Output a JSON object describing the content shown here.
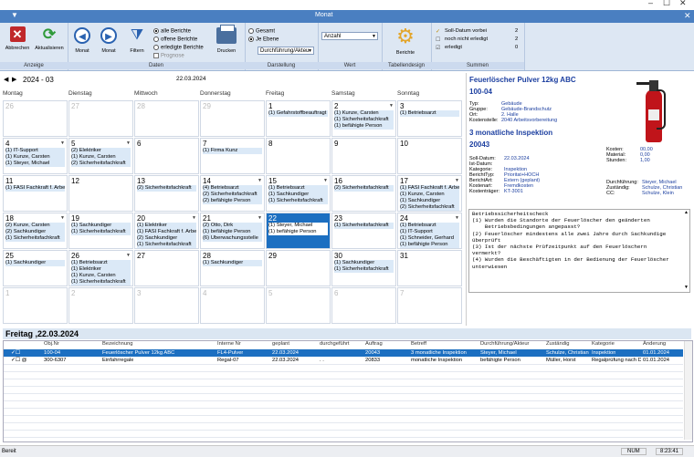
{
  "window": {
    "title": "Monat",
    "min": "–",
    "max": "☐",
    "close": "✕"
  },
  "ribbon": {
    "groups": {
      "anzeige": "Anzeige",
      "daten": "Daten",
      "darstellung": "Darstellung",
      "wert": "Wert",
      "tabellendesigner": "Tabellendesign",
      "summen": "Summen"
    },
    "buttons": {
      "abbrechen": "Abbrechen",
      "aktualisieren": "Aktualisieren",
      "monat_prev": "Monat",
      "monat_next": "Monat",
      "filtern": "Filtern",
      "drucken": "Drucken",
      "berichte": "Berichte"
    },
    "report_radios": [
      "alle Berichte",
      "offene Berichte",
      "erledigte Berichte"
    ],
    "prognose": "Prognose",
    "view_radios": [
      "Gesamt",
      "Je Ebene"
    ],
    "darstellung_select": "Durchführung/Akteu",
    "wert_select": "Anzahl",
    "summen": [
      {
        "label": "Soll-Datum vorbei",
        "value": "2"
      },
      {
        "label": "noch nicht erledigt",
        "value": "2"
      },
      {
        "label": "erledigt",
        "value": "0"
      }
    ]
  },
  "calendar": {
    "month_label": "2024 - 03",
    "date_label": "22.03.2024",
    "day_headers": [
      "Montag",
      "Dienstag",
      "Mittwoch",
      "Donnerstag",
      "Freitag",
      "Samstag",
      "Sonntag"
    ],
    "weeks": [
      [
        {
          "d": "26",
          "out": true,
          "ev": []
        },
        {
          "d": "27",
          "out": true,
          "ev": []
        },
        {
          "d": "28",
          "out": true,
          "ev": []
        },
        {
          "d": "29",
          "out": true,
          "ev": []
        },
        {
          "d": "1",
          "ev": [
            "(1) Gefahrstoffbeauftragt"
          ]
        },
        {
          "d": "2",
          "dd": true,
          "ev": [
            "(1) Kunze, Carsten",
            "(1) Sicherheitsfachkraft",
            "(1) befähigte Person"
          ]
        },
        {
          "d": "3",
          "ev": [
            "(1) Betriebsarzt"
          ]
        }
      ],
      [
        {
          "d": "4",
          "dd": true,
          "ev": [
            "(1) IT-Support",
            "(1) Kunze, Carsten",
            "(1) Steyer, Michael"
          ]
        },
        {
          "d": "5",
          "dd": true,
          "ev": [
            "(2) Elektriker",
            "(1) Kunze, Carsten",
            "(2) Sicherheitsfachkraft"
          ]
        },
        {
          "d": "6",
          "ev": []
        },
        {
          "d": "7",
          "ev": [
            "(1) Firma Kunz"
          ]
        },
        {
          "d": "8",
          "ev": []
        },
        {
          "d": "9",
          "ev": []
        },
        {
          "d": "10",
          "ev": []
        }
      ],
      [
        {
          "d": "11",
          "ev": [
            "(1) FASI Fachkraft f. Arbei"
          ]
        },
        {
          "d": "12",
          "ev": []
        },
        {
          "d": "13",
          "ev": [
            "(2) Sicherheitsfachkraft"
          ]
        },
        {
          "d": "14",
          "dd": true,
          "ev": [
            "(4) Betriebsarzt",
            "(2) Sicherheitsfachkraft",
            "(2) befähigte Person"
          ]
        },
        {
          "d": "15",
          "dd": true,
          "ev": [
            "(1) Betriebsarzt",
            "(1) Sachkundiger",
            "(1) Sicherheitsfachkraft"
          ]
        },
        {
          "d": "16",
          "ev": [
            "(2) Sicherheitsfachkraft"
          ]
        },
        {
          "d": "17",
          "dd": true,
          "ev": [
            "(1) FASI Fachkraft f. Arbei",
            "(1) Kunze, Carsten",
            "(1) Sachkundiger",
            "(2) Sicherheitsfachkraft"
          ]
        }
      ],
      [
        {
          "d": "18",
          "dd": true,
          "ev": [
            "(2) Kunze, Carsten",
            "(2) Sachkundiger",
            "(1) Sicherheitsfachkraft"
          ]
        },
        {
          "d": "19",
          "ev": [
            "(1) Sachkundiger",
            "(1) Sicherheitsfachkraft"
          ]
        },
        {
          "d": "20",
          "dd": true,
          "ev": [
            "(1) Elektriker",
            "(1) FASI Fachkraft f. Arbei",
            "(2) Sachkundiger",
            "(1) Sicherheitsfachkraft"
          ]
        },
        {
          "d": "21",
          "dd": true,
          "ev": [
            "(2) Otto, Dirk",
            "(1) befähigte Person",
            "(6) Überwachungsstelle"
          ]
        },
        {
          "d": "22",
          "today": true,
          "ev": [
            "(1) Steyer, Michael",
            "(1) befähigte Person"
          ]
        },
        {
          "d": "23",
          "ev": [
            "(1) Sicherheitsfachkraft"
          ]
        },
        {
          "d": "24",
          "dd": true,
          "ev": [
            "(1) Betriebsarzt",
            "(1) IT-Support",
            "(1) Schneider, Gerhard",
            "(1) befähigte Person"
          ]
        }
      ],
      [
        {
          "d": "25",
          "ev": [
            "(1) Sachkundiger"
          ]
        },
        {
          "d": "26",
          "dd": true,
          "ev": [
            "(1) Betriebsarzt",
            "(1) Elektriker",
            "(1) Kunze, Carsten",
            "(1) Sicherheitsfachkraft"
          ]
        },
        {
          "d": "27",
          "ev": []
        },
        {
          "d": "28",
          "ev": [
            "(1) Sachkundiger"
          ]
        },
        {
          "d": "29",
          "ev": []
        },
        {
          "d": "30",
          "ev": [
            "(1) Sachkundiger",
            "(1) Sicherheitsfachkraft"
          ]
        },
        {
          "d": "31",
          "ev": []
        }
      ],
      [
        {
          "d": "1",
          "out": true,
          "ev": []
        },
        {
          "d": "2",
          "out": true,
          "ev": []
        },
        {
          "d": "3",
          "out": true,
          "ev": []
        },
        {
          "d": "4",
          "out": true,
          "ev": []
        },
        {
          "d": "5",
          "out": true,
          "ev": []
        },
        {
          "d": "6",
          "out": true,
          "ev": []
        },
        {
          "d": "7",
          "out": true,
          "ev": []
        }
      ]
    ]
  },
  "detail": {
    "title": "Feuerlöscher Pulver 12kg ABC",
    "id": "100-04",
    "fields": [
      {
        "k": "Typ:",
        "v": "Gebäude"
      },
      {
        "k": "Gruppe:",
        "v": "Gebäude-Brandschutz"
      },
      {
        "k": "Ort:",
        "v": "2. Halle"
      },
      {
        "k": "Kostenstelle:",
        "v": "2040 Arbeitsvorbereitung"
      }
    ],
    "inspection_title": "3 monatliche Inspektion",
    "inspection_id": "20043",
    "costs": [
      {
        "k": "Kosten:",
        "v": "00,00"
      },
      {
        "k": "Material:",
        "v": "0,00"
      },
      {
        "k": "Stunden:",
        "v": "1,00"
      }
    ],
    "fields2": [
      {
        "k": "Soll-Datum:",
        "v": "22.03.2024"
      },
      {
        "k": "Ist-Datum:",
        "v": ""
      },
      {
        "k": "Kategorie:",
        "v": "Inspektion"
      },
      {
        "k": "BerichtTyp:",
        "v": "Prioritat+HOCH"
      },
      {
        "k": "BerichtArt:",
        "v": "Extern (geplant)"
      },
      {
        "k": "Kostenart:",
        "v": "Fremdkosten"
      },
      {
        "k": "Kostenträger:",
        "v": "KT-3001"
      }
    ],
    "people": [
      {
        "k": "Durchführung:",
        "v": "Steyer, Michael"
      },
      {
        "k": "Zuständig:",
        "v": "Schulze, Christian"
      },
      {
        "k": "CC:",
        "v": "Schulze, Klein"
      }
    ],
    "memo": [
      "Betriebssicherheitscheck",
      "(1) Wurden die Standorte der Feuerlöscher den geänderten",
      "    Betriebsbedingungen angepasst?",
      "(2) Feuerlöscher mindestens alle zwei Jahre durch Sachkundige",
      "überprüft",
      "(3) Ist der nächste Prüfzeitpunkt auf den Feuerlöschern",
      "vermerkt?",
      "(4) Wurden die Beschäftigten in der Bedienung der Feuerlöscher",
      "unterwiesen"
    ]
  },
  "list": {
    "heading": "Freitag ,22.03.2024",
    "columns": [
      "Obj.Nr",
      "Bezeichnung",
      "Interne Nr",
      "geplant",
      "durchgeführt",
      "Auftrag",
      "Betreff",
      "Durchführung/Akteur",
      "Zuständig",
      "Kategorie",
      "Änderung"
    ],
    "rows": [
      [
        "100-04",
        "Feuerlöscher Pulver 12kg ABC",
        "FL4-Pulver",
        "22.03.2024",
        "",
        "20043",
        "3 monatliche Inspektion",
        "Steyer, Michael",
        "Schulze, Christian",
        "Inspektion",
        "01.01.2024"
      ],
      [
        "300-6307",
        "Einfahrregale",
        "Regal-07",
        "22.03.2024",
        ". .",
        "20833",
        "monatliche Inspektion",
        "befähigte Person",
        "Müller, Horst",
        "Regalprüfung nach D",
        "01.01.2024"
      ]
    ]
  },
  "status": {
    "left": "Bereit",
    "num": "NUM",
    "time": "8:23:41"
  }
}
